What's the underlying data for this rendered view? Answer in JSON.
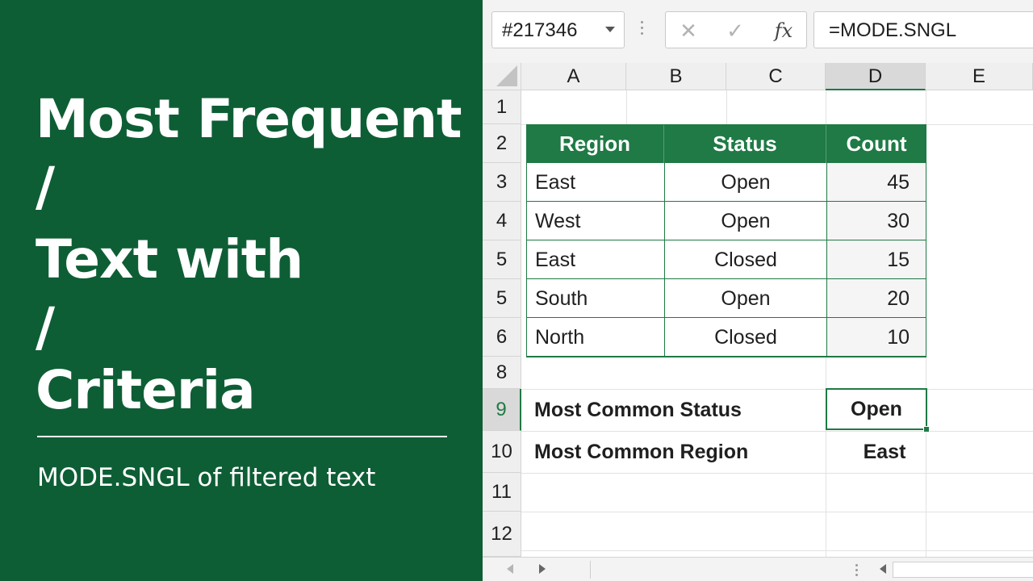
{
  "title_lines": [
    "Most Frequent",
    "/",
    "Text with",
    "/",
    "Criteria"
  ],
  "subtitle": "MODE.SNGL of filtered text",
  "formula_bar": {
    "name_box": "#217346",
    "cancel_icon": "✕",
    "enter_icon": "✓",
    "fx_label": "fx",
    "formula": "=MODE.SNGL"
  },
  "columns": [
    "A",
    "B",
    "C",
    "D",
    "E"
  ],
  "active_column": "D",
  "row_numbers": [
    "1",
    "2",
    "3",
    "4",
    "5",
    "5",
    "6",
    "8",
    "9",
    "10",
    "11",
    "12"
  ],
  "active_row": "9",
  "table": {
    "headers": [
      "Region",
      "Status",
      "Count"
    ],
    "rows": [
      {
        "region": "East",
        "status": "Open",
        "count": "45"
      },
      {
        "region": "West",
        "status": "Open",
        "count": "30"
      },
      {
        "region": "East",
        "status": "Closed",
        "count": "15"
      },
      {
        "region": "South",
        "status": "Open",
        "count": "20"
      },
      {
        "region": "North",
        "status": "Closed",
        "count": "10"
      }
    ]
  },
  "summary": {
    "status_label": "Most Common Status",
    "status_value": "Open",
    "region_label": "Most Common Region",
    "region_value": "East"
  },
  "colors": {
    "brand_green": "#0e5e35",
    "table_header": "#1f7a45"
  }
}
